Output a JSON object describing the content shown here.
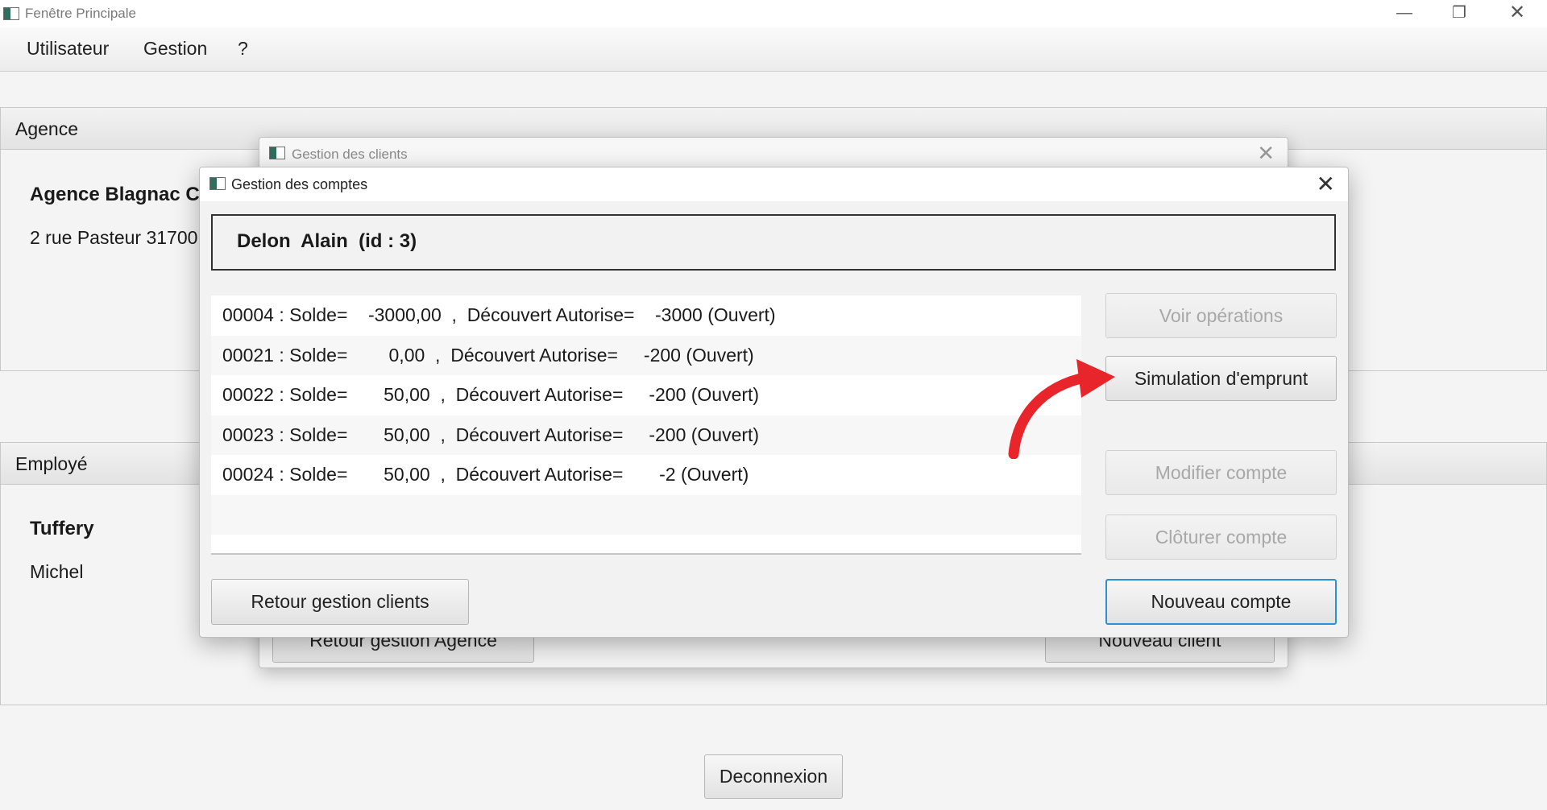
{
  "window": {
    "title": "Fenêtre Principale",
    "min": "—",
    "max": "❐",
    "close": "✕"
  },
  "menu": [
    "Utilisateur",
    "Gestion",
    "?"
  ],
  "agence": {
    "header": "Agence",
    "name": "Agence Blagnac Ce",
    "address": "2 rue Pasteur 31700"
  },
  "employe": {
    "header": "Employé",
    "lastname": "Tuffery",
    "firstname": "Michel"
  },
  "logout_label": "Deconnexion",
  "back_dialog": {
    "title": "Gestion des clients",
    "close": "✕",
    "left_button": "Retour gestion Agence",
    "right_button": "Nouveau client"
  },
  "front_dialog": {
    "title": "Gestion des comptes",
    "close": "✕",
    "client": "Delon  Alain  (id : 3)",
    "accounts": [
      "00004 : Solde=    -3000,00  ,  Découvert Autorise=    -3000 (Ouvert)",
      "00021 : Solde=        0,00  ,  Découvert Autorise=     -200 (Ouvert)",
      "00022 : Solde=       50,00  ,  Découvert Autorise=     -200 (Ouvert)",
      "00023 : Solde=       50,00  ,  Découvert Autorise=     -200 (Ouvert)",
      "00024 : Solde=       50,00  ,  Découvert Autorise=       -2 (Ouvert)"
    ],
    "buttons": {
      "voir_operations": "Voir opérations",
      "simulation": "Simulation d'emprunt",
      "modifier": "Modifier compte",
      "cloturer": "Clôturer compte",
      "nouveau": "Nouveau compte",
      "retour": "Retour gestion clients"
    }
  },
  "annotation": {
    "arrow_color": "#e8252b"
  }
}
